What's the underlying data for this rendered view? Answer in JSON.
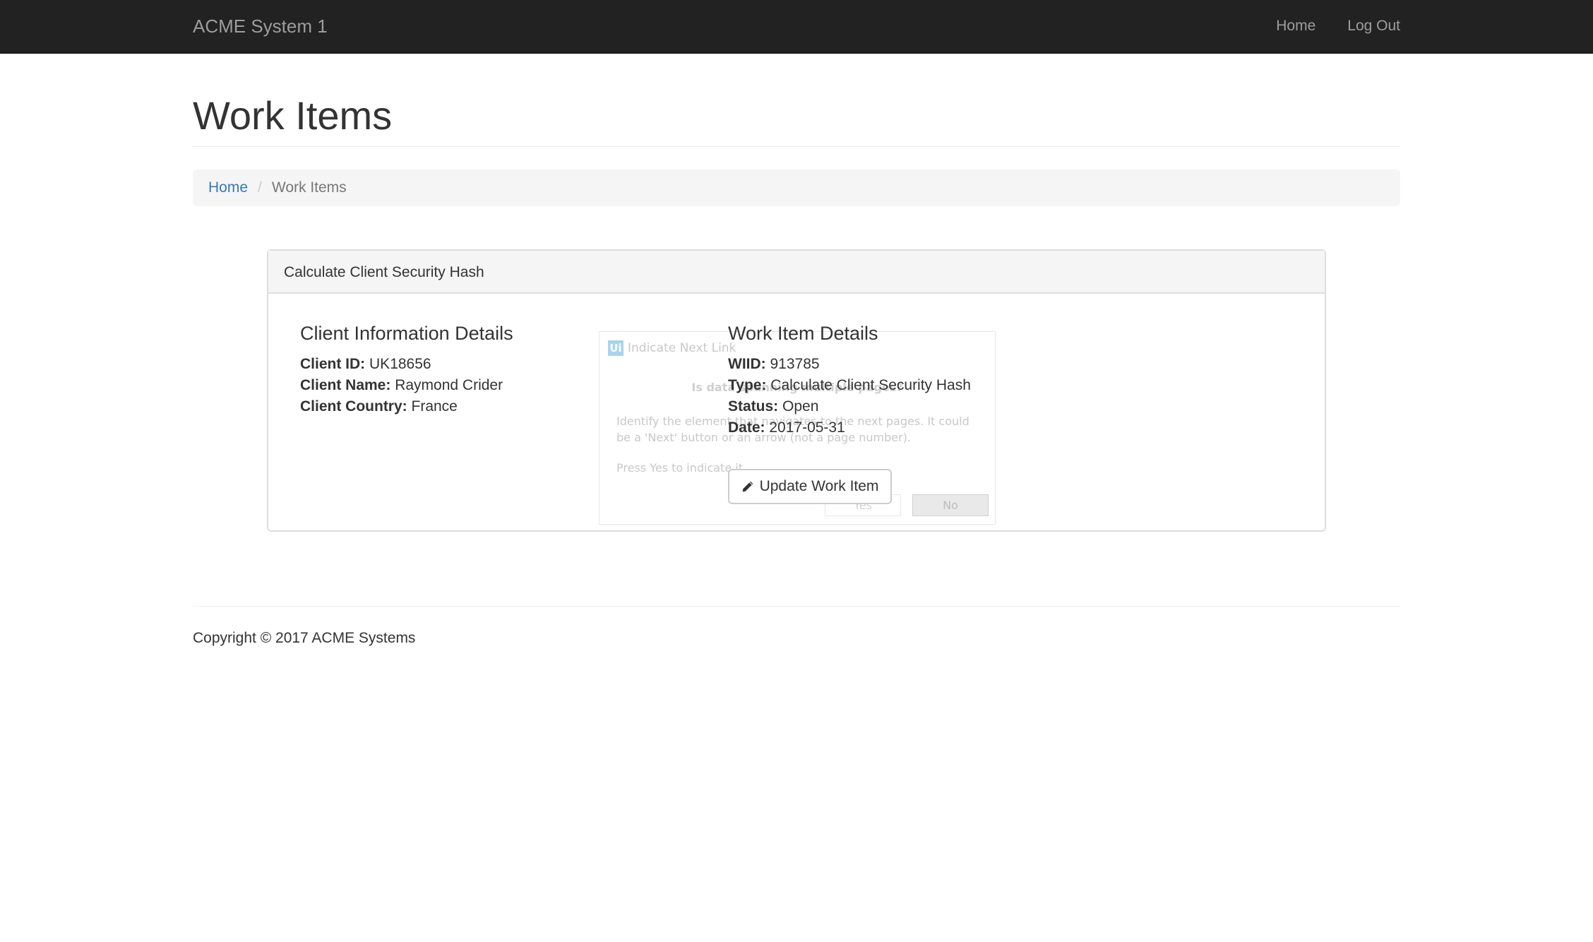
{
  "navbar": {
    "brand": "ACME System 1",
    "links": [
      "Home",
      "Log Out"
    ]
  },
  "page": {
    "title": "Work Items"
  },
  "breadcrumb": {
    "home": "Home",
    "separator": "/",
    "current": "Work Items"
  },
  "panel": {
    "heading": "Calculate Client Security Hash",
    "client": {
      "title": "Client Information Details",
      "fields": [
        {
          "label": "Client ID:",
          "value": "UK18656"
        },
        {
          "label": "Client Name:",
          "value": "Raymond Crider"
        },
        {
          "label": "Client Country:",
          "value": "France"
        }
      ]
    },
    "work_item": {
      "title": "Work Item Details",
      "fields": [
        {
          "label": "WIID:",
          "value": "913785"
        },
        {
          "label": "Type:",
          "value": "Calculate Client Security Hash"
        },
        {
          "label": "Status:",
          "value": "Open"
        },
        {
          "label": "Date:",
          "value": "2017-05-31"
        }
      ],
      "button": "Update Work Item",
      "button_icon": "pencil-icon"
    }
  },
  "overlay_dialog": {
    "logo": "Ui",
    "title": "Indicate Next Link",
    "question": "Is data spanning multiple pages?",
    "description": "Identify the element that navigates to the next pages. It could be a 'Next' button or an arrow (not a page number).",
    "instruction": "Press Yes to indicate it.",
    "yes": "Yes",
    "no": "No"
  },
  "footer": {
    "text": "Copyright © 2017 ACME Systems"
  },
  "colors": {
    "navbar_bg": "#222222",
    "link": "#337ab7",
    "panel_heading_bg": "#f5f5f5"
  }
}
